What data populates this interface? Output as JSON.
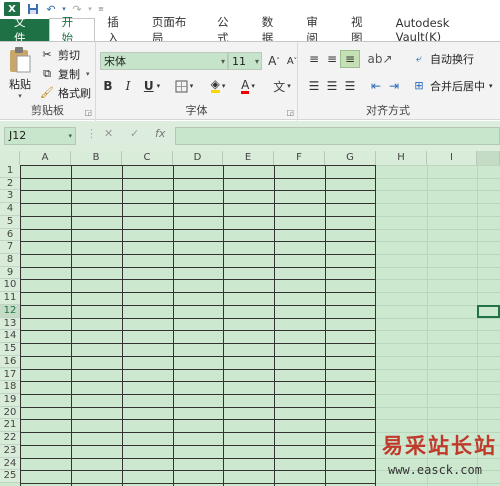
{
  "quick_access": {
    "excel_icon": "X",
    "save_icon": "save-icon",
    "undo_icon": "↶",
    "redo_icon": "↷"
  },
  "tabs": [
    "文件",
    "开始",
    "插入",
    "页面布局",
    "公式",
    "数据",
    "审阅",
    "视图",
    "Autodesk Vault(K)"
  ],
  "ribbon": {
    "clipboard": {
      "paste": "粘贴",
      "cut": "剪切",
      "copy": "复制",
      "format_painter": "格式刷",
      "label": "剪贴板"
    },
    "font": {
      "name": "宋体",
      "size": "11",
      "bold": "B",
      "italic": "I",
      "underline": "U",
      "label": "字体",
      "grow": "A",
      "shrink": "A",
      "phonetic": "文"
    },
    "alignment": {
      "wrap_text": "自动换行",
      "merge_center": "合并后居中",
      "label": "对齐方式"
    }
  },
  "formula_bar": {
    "name_box": "J12",
    "cancel": "✕",
    "enter": "✓",
    "fx": "fx",
    "formula": ""
  },
  "columns": [
    "A",
    "B",
    "C",
    "D",
    "E",
    "F",
    "G",
    "H",
    "I"
  ],
  "rows": [
    "1",
    "2",
    "3",
    "4",
    "5",
    "6",
    "7",
    "8",
    "9",
    "10",
    "11",
    "12",
    "13",
    "14",
    "15",
    "16",
    "17",
    "18",
    "19",
    "20",
    "21",
    "22",
    "23",
    "24",
    "25"
  ],
  "watermark": {
    "title": "易采站长站",
    "url": "www.easck.com"
  },
  "colors": {
    "excel_green": "#1e7145",
    "sheet_bg": "#cce8cf",
    "watermark_red": "#c0392b"
  }
}
